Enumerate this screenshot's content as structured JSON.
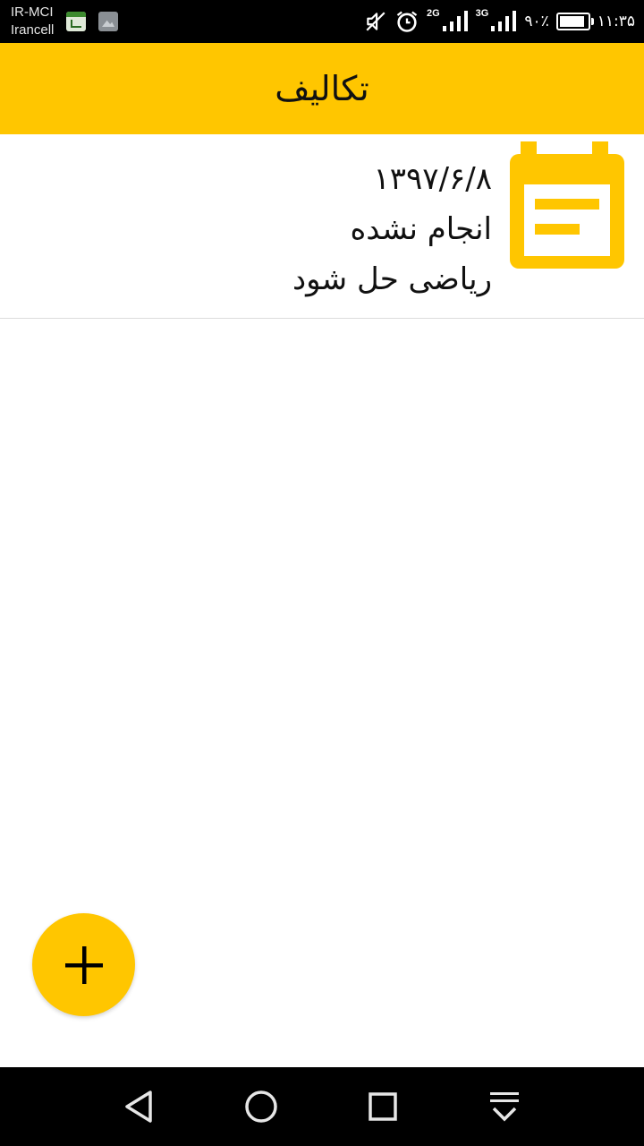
{
  "status_bar": {
    "carrier_1": "IR-MCI",
    "carrier_2": "Irancell",
    "network_1": "2G",
    "network_2": "3G",
    "battery_percent": "۹۰٪",
    "battery_level": 0.9,
    "time": "۱۱:۳۵",
    "icons": [
      "app-notification-icon",
      "gallery-notification-icon",
      "mute-icon",
      "alarm-icon",
      "signal-icon",
      "battery-icon"
    ]
  },
  "app_bar": {
    "title": "تکالیف"
  },
  "tasks": [
    {
      "date": "۱۳۹۷/۶/۸",
      "status": "انجام نشده",
      "title": "ریاضی حل شود",
      "icon": "event-note-icon"
    }
  ],
  "fab": {
    "icon": "plus-icon"
  },
  "nav_bar": {
    "icons": [
      "back-icon",
      "home-icon",
      "recent-apps-icon",
      "notification-pull-icon"
    ]
  },
  "colors": {
    "accent": "#ffc600",
    "app_bar": "#ffc600",
    "status_bar": "#000000",
    "nav_bar": "#000000",
    "text": "#111111",
    "divider": "#dcdcdc"
  }
}
